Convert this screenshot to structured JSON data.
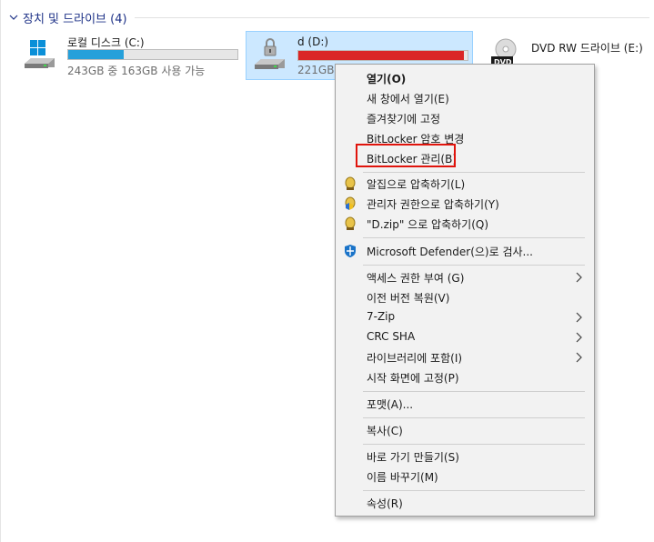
{
  "group": {
    "title": "장치 및 드라이브 (4)"
  },
  "drives": [
    {
      "name": "로컬 디스크 (C:)",
      "free_text": "243GB 중 163GB 사용 가능",
      "used_fraction": 0.33,
      "bar_color": "#26a0da"
    },
    {
      "name": "d (D:)",
      "free_text": "221GB",
      "used_fraction": 0.98,
      "bar_color": "#da2626"
    },
    {
      "name": "DVD RW 드라이브 (E:)",
      "badge": "DVD"
    }
  ],
  "context_menu": {
    "items": [
      {
        "label": "열기(O)"
      },
      {
        "label": "새 창에서 열기(E)"
      },
      {
        "label": "즐겨찾기에 고정"
      },
      {
        "label": "BitLocker 암호 변경"
      },
      {
        "label": "BitLocker 관리(B)"
      },
      {
        "label": "알집으로 압축하기(L)"
      },
      {
        "label": "관리자 권한으로 압축하기(Y)"
      },
      {
        "label": "\"D.zip\" 으로 압축하기(Q)"
      },
      {
        "label": "Microsoft Defender(으)로 검사..."
      },
      {
        "label": "액세스 권한 부여 (G)"
      },
      {
        "label": "이전 버전 복원(V)"
      },
      {
        "label": "7-Zip"
      },
      {
        "label": "CRC SHA"
      },
      {
        "label": "라이브러리에 포함(I)"
      },
      {
        "label": "시작 화면에 고정(P)"
      },
      {
        "label": "포맷(A)..."
      },
      {
        "label": "복사(C)"
      },
      {
        "label": "바로 가기 만들기(S)"
      },
      {
        "label": "이름 바꾸기(M)"
      },
      {
        "label": "속성(R)"
      }
    ]
  },
  "colors": {
    "accent": "#1e3287",
    "selection_bg": "#cce8ff",
    "highlight_border": "#e0140c"
  },
  "icons": [
    "chevron-down-icon",
    "windows-drive-icon",
    "locked-drive-icon",
    "dvd-drive-icon",
    "alzip-icon",
    "shield-admin-icon",
    "defender-icon",
    "chevron-right-icon"
  ]
}
